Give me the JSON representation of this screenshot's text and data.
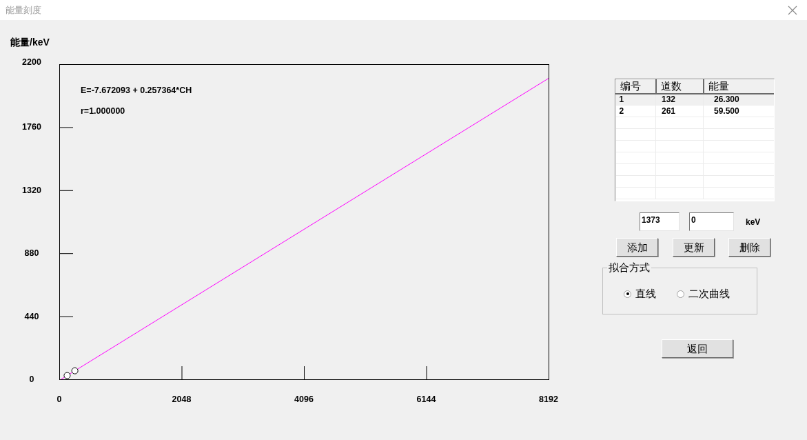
{
  "window": {
    "title": "能量刻度"
  },
  "chart": {
    "chart_data": {
      "type": "line",
      "ylabel": "能量/keV",
      "x": [
        30,
        8192
      ],
      "series": [
        {
          "color": "#ff00ff",
          "values": [
            0,
            2101
          ]
        }
      ],
      "xlim": [
        0,
        8192
      ],
      "ylim": [
        0,
        2200
      ],
      "xticks": [
        0,
        2048,
        4096,
        6144,
        8192
      ],
      "yticks": [
        0,
        440,
        880,
        1320,
        1760,
        2200
      ],
      "annotations": [
        "E=-7.672093 + 0.257364*CH",
        "r=1.000000"
      ]
    }
  },
  "table": {
    "columns": [
      "编号",
      "道数",
      "能量"
    ],
    "rows": [
      {
        "cells": [
          "1",
          "132",
          "26.300"
        ],
        "selected": true
      },
      {
        "cells": [
          "2",
          "261",
          "59.500"
        ],
        "selected": false
      }
    ]
  },
  "inputs": [
    {
      "value": "1373"
    },
    {
      "value": "0"
    }
  ],
  "unit": "keV",
  "buttons": [
    "添加",
    "更新",
    "删除"
  ],
  "fit_method": {
    "title": "拟合方式",
    "options": [
      {
        "label": "直线",
        "selected": true
      },
      {
        "label": "二次曲线",
        "selected": false
      }
    ]
  },
  "return_button": "返回"
}
